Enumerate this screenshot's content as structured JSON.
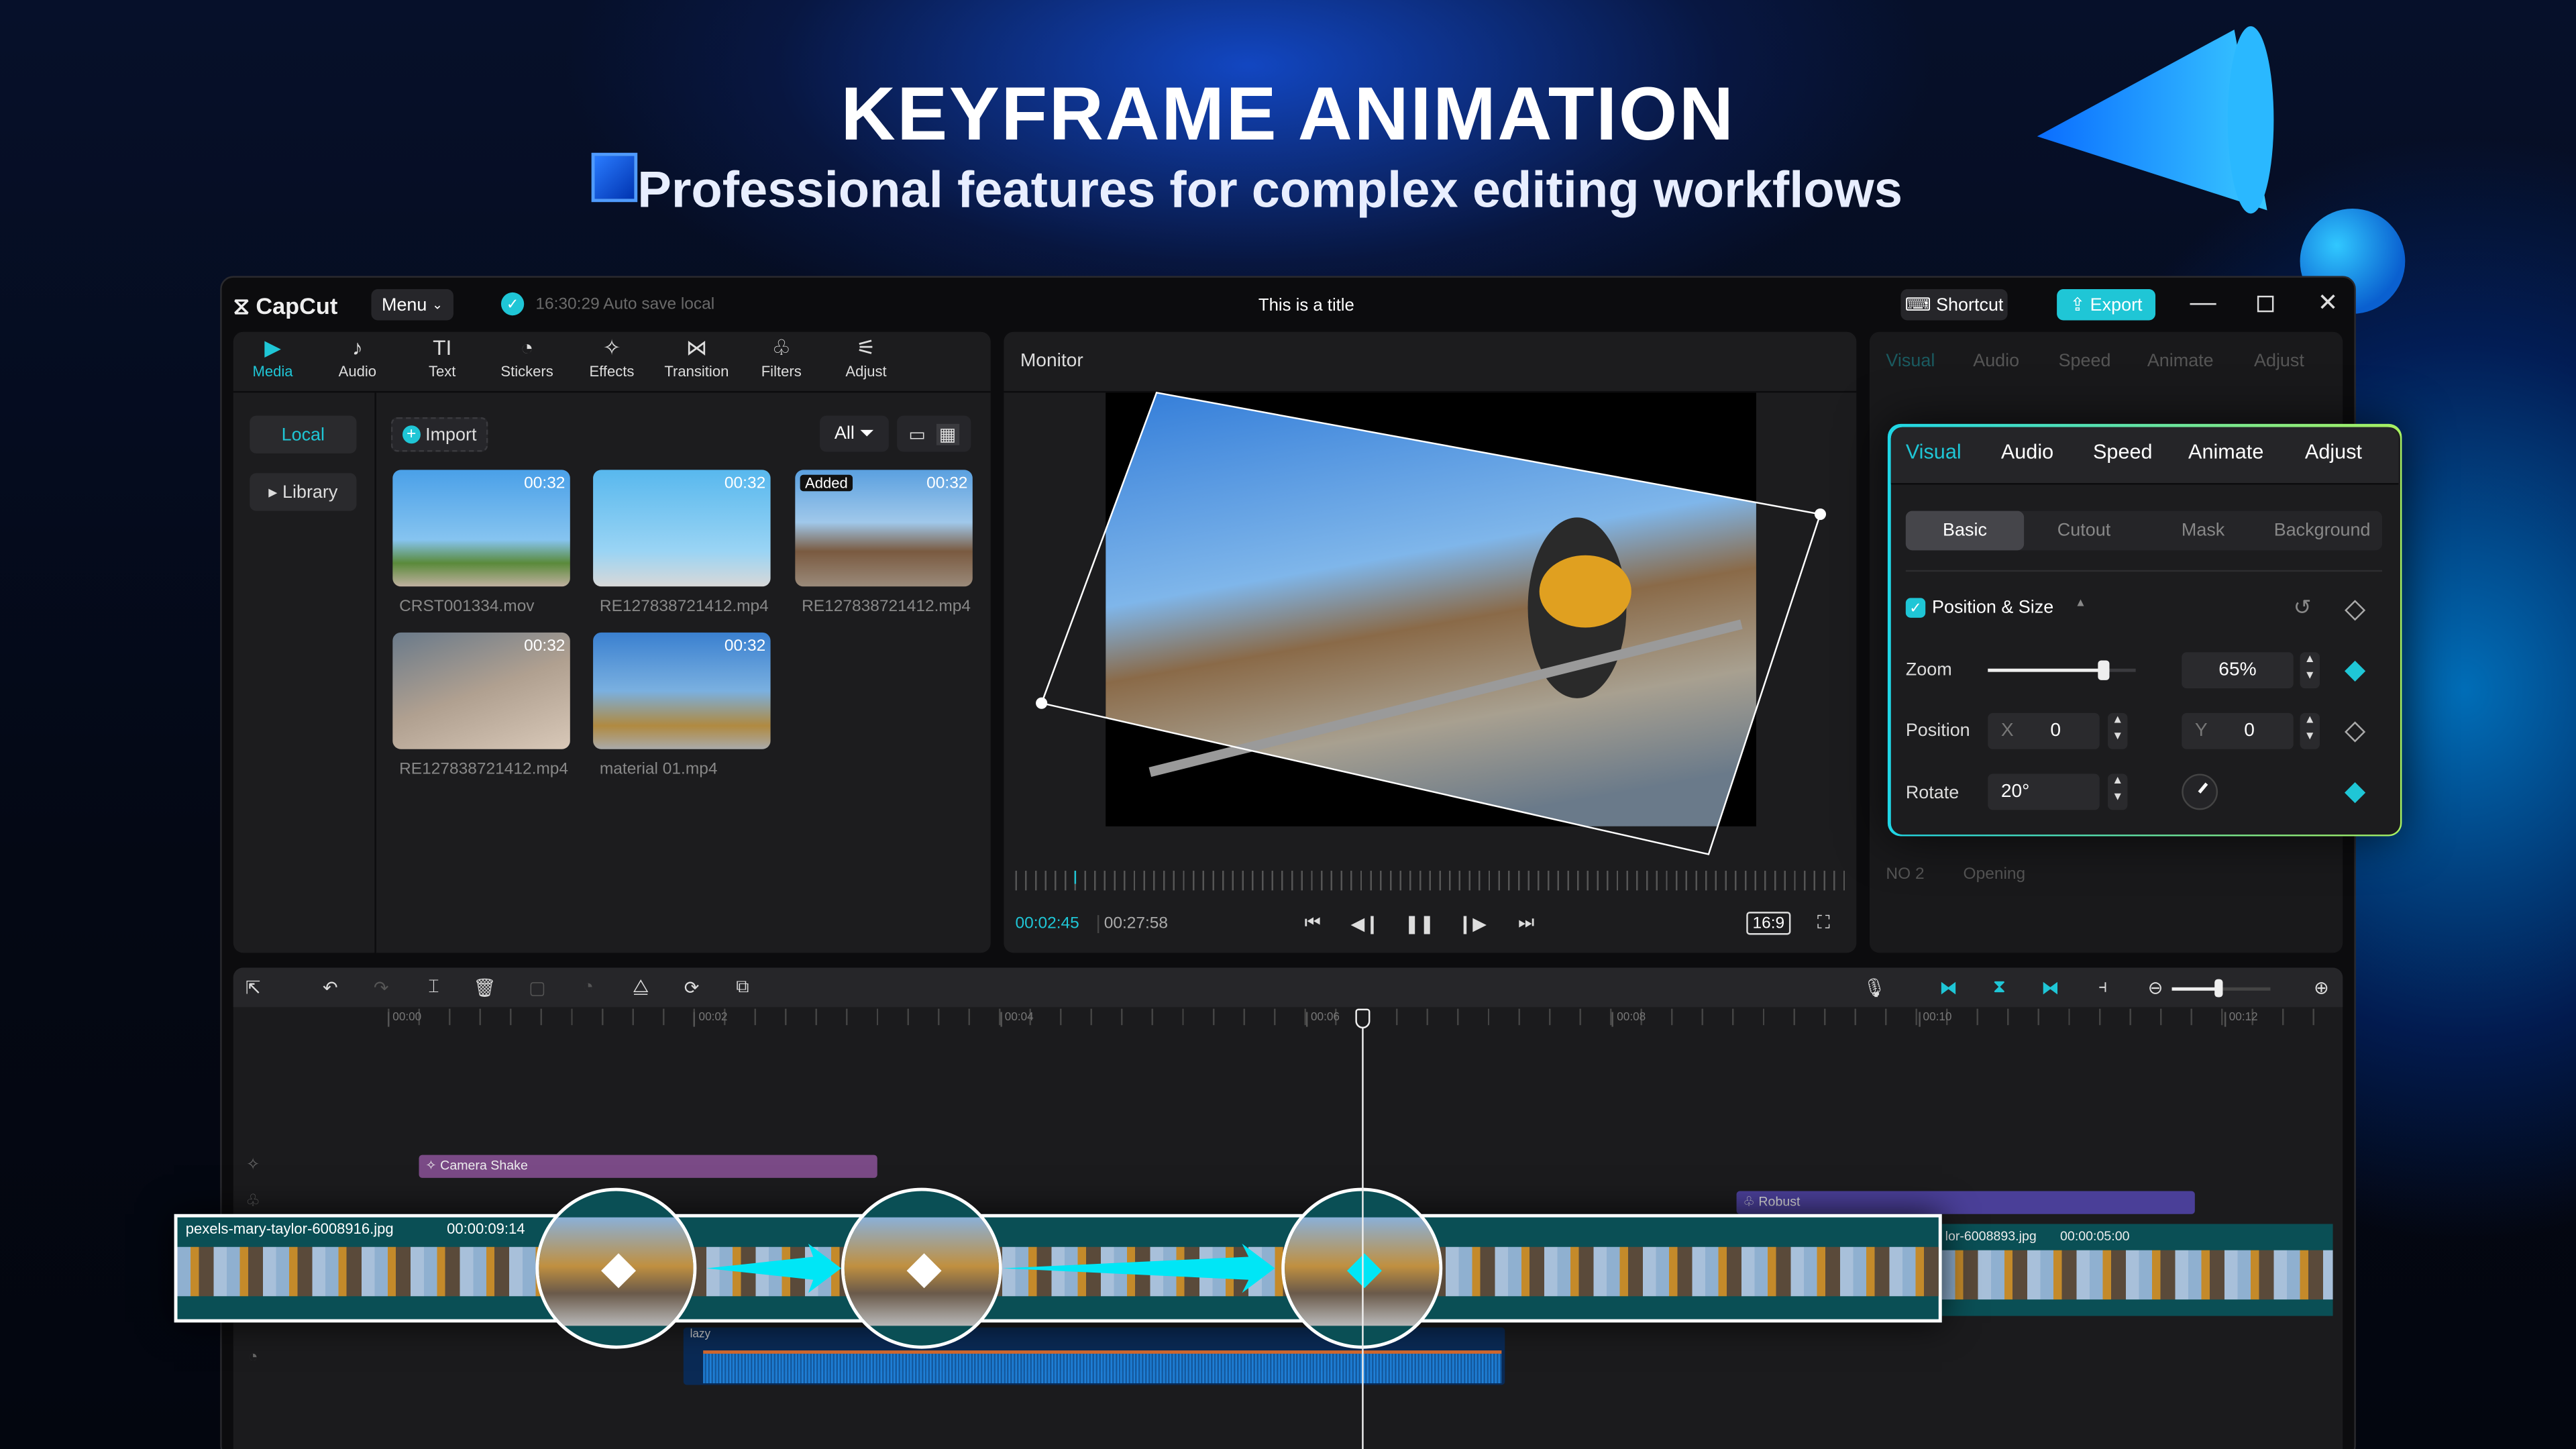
{
  "hero": {
    "title": "KEYFRAME ANIMATION",
    "subtitle": "Professional features for complex editing workflows"
  },
  "titlebar": {
    "logo": "CapCut",
    "menu": "Menu",
    "autosave": "16:30:29 Auto save local",
    "project_title": "This is a title",
    "shortcut": "Shortcut",
    "export": "Export"
  },
  "toolbar": {
    "items": [
      {
        "label": "Media",
        "icon": "media-icon",
        "active": true
      },
      {
        "label": "Audio",
        "icon": "audio-icon"
      },
      {
        "label": "Text",
        "icon": "text-icon"
      },
      {
        "label": "Stickers",
        "icon": "stickers-icon"
      },
      {
        "label": "Effects",
        "icon": "effects-icon"
      },
      {
        "label": "Transition",
        "icon": "transition-icon"
      },
      {
        "label": "Filters",
        "icon": "filters-icon"
      },
      {
        "label": "Adjust",
        "icon": "adjust-icon"
      }
    ]
  },
  "media": {
    "sidebar": {
      "local": "Local",
      "library": "Library"
    },
    "import": "Import",
    "filter": "All",
    "items": [
      {
        "name": "CRST001334.mov",
        "duration": "00:32"
      },
      {
        "name": "RE127838721412.mp4",
        "duration": "00:32"
      },
      {
        "name": "RE127838721412.mp4",
        "duration": "00:32",
        "badge": "Added"
      },
      {
        "name": "RE127838721412.mp4",
        "duration": "00:32"
      },
      {
        "name": "material 01.mp4",
        "duration": "00:32"
      }
    ]
  },
  "monitor": {
    "title": "Monitor",
    "current_time": "00:02:45",
    "total_time": "00:27:58",
    "aspect": "16:9"
  },
  "inspector_bg": {
    "tabs": [
      "Visual",
      "Audio",
      "Speed",
      "Animate",
      "Adjust"
    ],
    "no": "NO 2",
    "opening": "Opening"
  },
  "inspector": {
    "tabs": [
      "Visual",
      "Audio",
      "Speed",
      "Animate",
      "Adjust"
    ],
    "active_tab": "Visual",
    "subtabs": [
      "Basic",
      "Cutout",
      "Mask",
      "Background"
    ],
    "active_subtab": "Basic",
    "section": "Position & Size",
    "section_checked": true,
    "zoom": {
      "label": "Zoom",
      "value": "65%",
      "slider_percent": 65
    },
    "position": {
      "label": "Position",
      "x_label": "X",
      "x": "0",
      "y_label": "Y",
      "y": "0"
    },
    "rotate": {
      "label": "Rotate",
      "value": "20°"
    },
    "accent": "#1fc6d6"
  },
  "timeline": {
    "ruler": [
      "00:00",
      "00:02",
      "00:04",
      "00:06",
      "00:08",
      "00:10",
      "00:12"
    ],
    "effect_clip": "Camera Shake",
    "filter_clip": "Robust",
    "main_clip": {
      "name": "pexels-mary-taylor-6008916.jpg",
      "duration": "00:00:09:14"
    },
    "next_clip": {
      "name": "lor-6008893.jpg",
      "duration": "00:00:05:00"
    },
    "audio_clip": "lazy"
  }
}
